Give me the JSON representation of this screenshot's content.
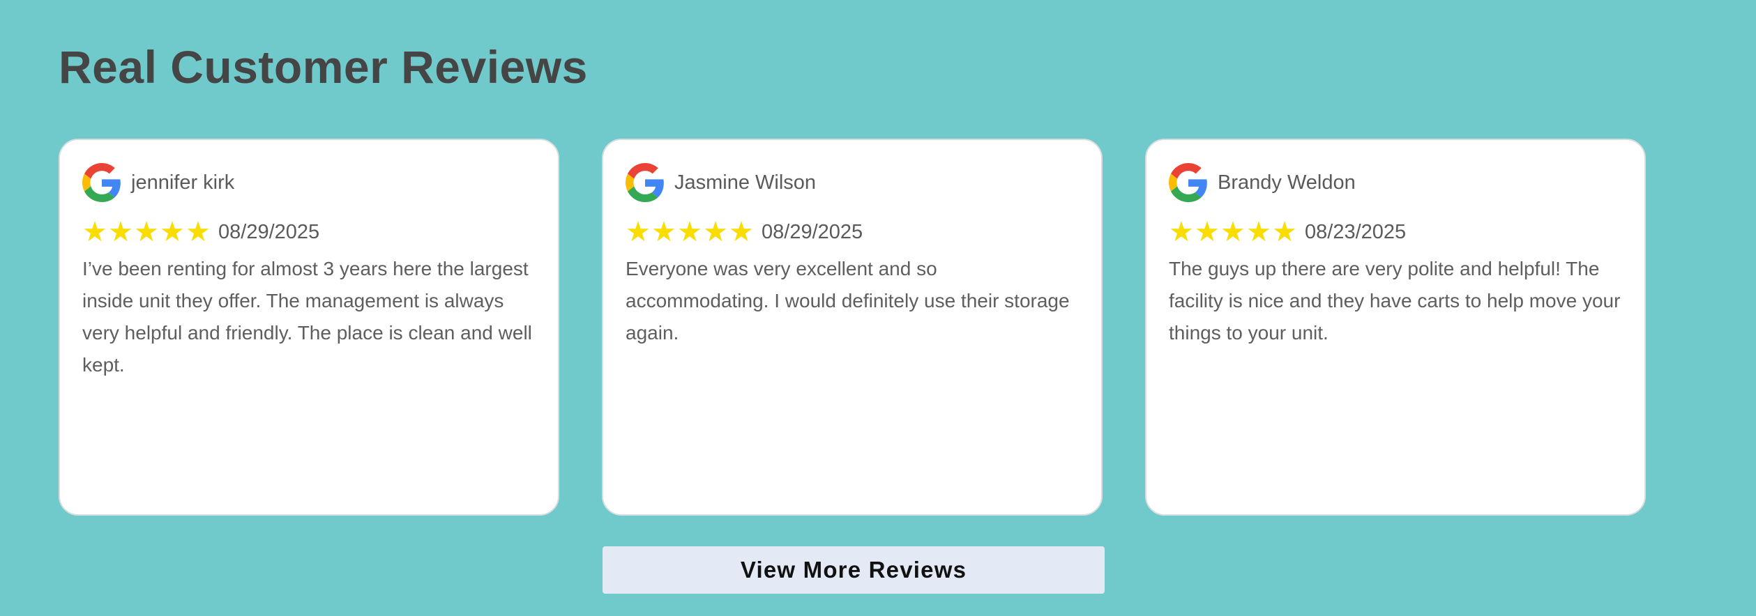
{
  "section": {
    "title": "Real Customer Reviews"
  },
  "reviews": [
    {
      "source_icon": "google-icon",
      "name": "jennifer kirk",
      "rating": 5,
      "stars": "★★★★★",
      "date": "08/29/2025",
      "text": "I’ve been renting for almost 3 years here the largest inside unit they offer. The management is always very helpful and friendly. The place is clean and well kept."
    },
    {
      "source_icon": "google-icon",
      "name": "Jasmine Wilson",
      "rating": 5,
      "stars": "★★★★★",
      "date": "08/29/2025",
      "text": "Everyone was very excellent and so accommodating. I would definitely use their storage again."
    },
    {
      "source_icon": "google-icon",
      "name": "Brandy Weldon",
      "rating": 5,
      "stars": "★★★★★",
      "date": "08/23/2025",
      "text": "The guys up there are very polite and helpful! The facility is nice and they have carts to help move your things to your unit."
    }
  ],
  "actions": {
    "view_more_label": "View More Reviews"
  },
  "colors": {
    "background": "#70c9ca",
    "card": "#ffffff",
    "star": "#f9dc00",
    "button": "#e4e9f6",
    "title": "#454545"
  }
}
